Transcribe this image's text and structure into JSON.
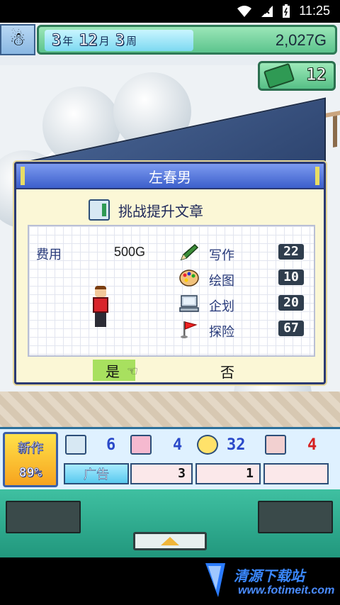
{
  "status_bar": {
    "time": "11:25"
  },
  "hud": {
    "date": {
      "year": "3",
      "year_unit": "年",
      "month": "12",
      "month_unit": "月",
      "week": "3",
      "week_unit": "周"
    },
    "gold": "2,027G",
    "books": "12"
  },
  "dialog": {
    "name": "左春男",
    "task": "挑战提升文章",
    "fee_label": "费用",
    "fee_value": "500G",
    "stats": [
      {
        "label": "写作",
        "value": "22",
        "icon": "pencil-icon"
      },
      {
        "label": "绘图",
        "value": "10",
        "icon": "palette-icon"
      },
      {
        "label": "企划",
        "value": "20",
        "icon": "computer-icon"
      },
      {
        "label": "探险",
        "value": "67",
        "icon": "flag-icon"
      }
    ],
    "yes": "是",
    "no": "否"
  },
  "bottom_hud": {
    "new_work_label": "新作",
    "new_work_percent": "89%",
    "counts": [
      {
        "icon": "notebook-icon",
        "value": "6"
      },
      {
        "icon": "camera-icon",
        "value": "4"
      },
      {
        "icon": "smiley-icon",
        "value": "32"
      },
      {
        "icon": "printer-icon",
        "value": "4"
      }
    ],
    "ad_label": "广告",
    "ad_values": [
      "3",
      "1"
    ]
  },
  "watermark": {
    "title": "清源下载站",
    "url": "www.fotimeit.com"
  }
}
